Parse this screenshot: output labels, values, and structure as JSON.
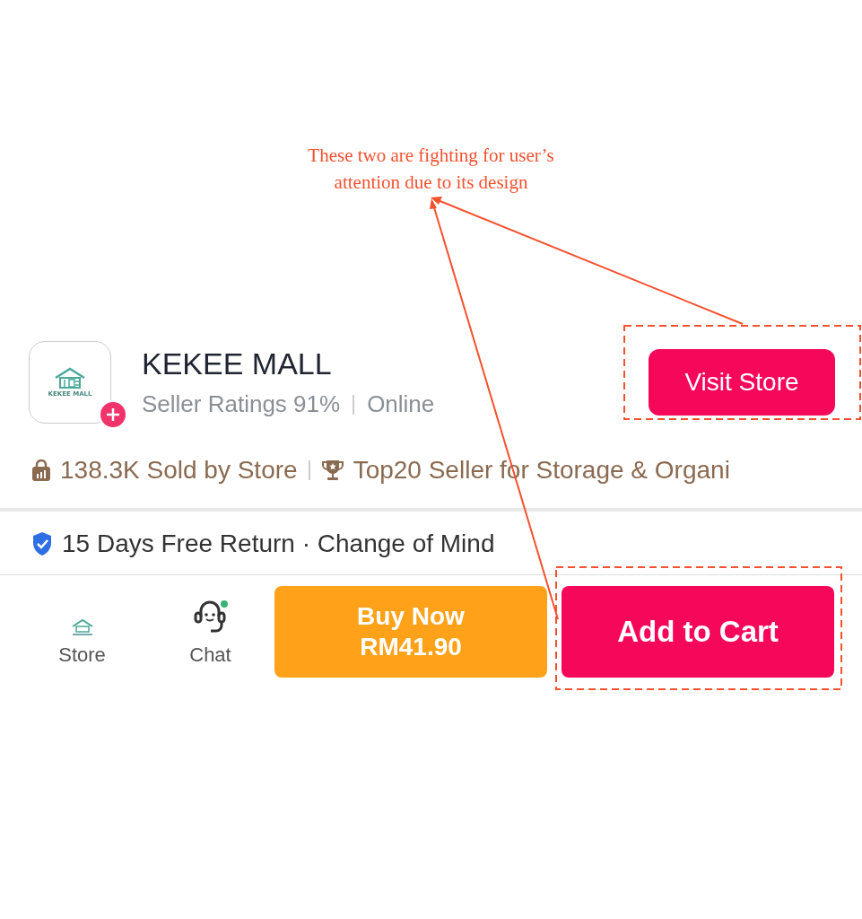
{
  "annotation": {
    "text": "These two are fighting for user’s attention due to its design"
  },
  "store": {
    "name": "KEKEE MALL",
    "logo_caption": "KEKEE MALL",
    "rating": "Seller Ratings 91%",
    "status": "Online",
    "visit_button": "Visit Store"
  },
  "badges": [
    {
      "kind": "sold",
      "text": "138.3K Sold by Store"
    },
    {
      "kind": "top",
      "text": "Top20 Seller for Storage & Organi"
    }
  ],
  "return_policy": "15 Days Free Return · Change of Mind",
  "nav": [
    {
      "kind": "store",
      "label": "Store"
    },
    {
      "kind": "chat",
      "label": "Chat"
    }
  ],
  "buy_now": {
    "label": "Buy Now",
    "price": "RM41.90"
  },
  "add_to_cart": "Add to Cart"
}
